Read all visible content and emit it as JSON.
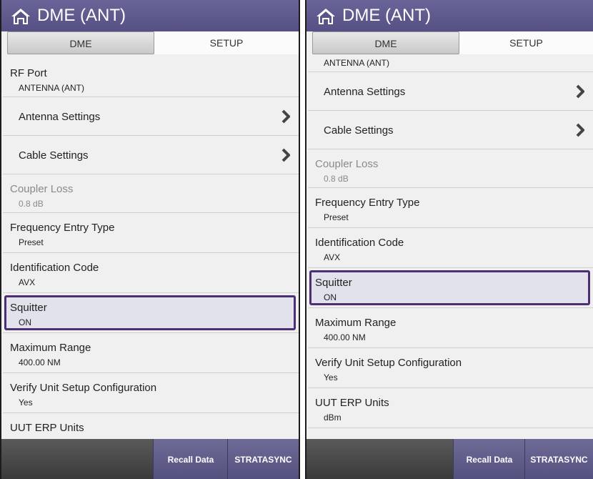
{
  "title": "DME (ANT)",
  "tabs": {
    "dme": "DME",
    "setup": "SETUP"
  },
  "settings": [
    {
      "label": "RF Port",
      "value": "ANTENNA (ANT)"
    },
    {
      "label": "Antenna Settings"
    },
    {
      "label": "Cable Settings"
    },
    {
      "label": "Coupler Loss",
      "value": "0.8 dB"
    },
    {
      "label": "Frequency Entry Type",
      "value": "Preset"
    },
    {
      "label": "Identification Code",
      "value": "AVX"
    },
    {
      "label": "Squitter",
      "value": "ON"
    },
    {
      "label": "Maximum Range",
      "value": "400.00 NM"
    },
    {
      "label": "Verify Unit Setup Configuration",
      "value": "Yes"
    },
    {
      "label": "UUT ERP Units",
      "value": "dBm"
    }
  ],
  "toolbar": {
    "recall": "Recall Data",
    "stratasync": "STRATASYNC"
  },
  "colors": {
    "title_bar": "#5a5587",
    "selection_border": "#4d2f73",
    "disabled_text": "#8a8a8a"
  }
}
